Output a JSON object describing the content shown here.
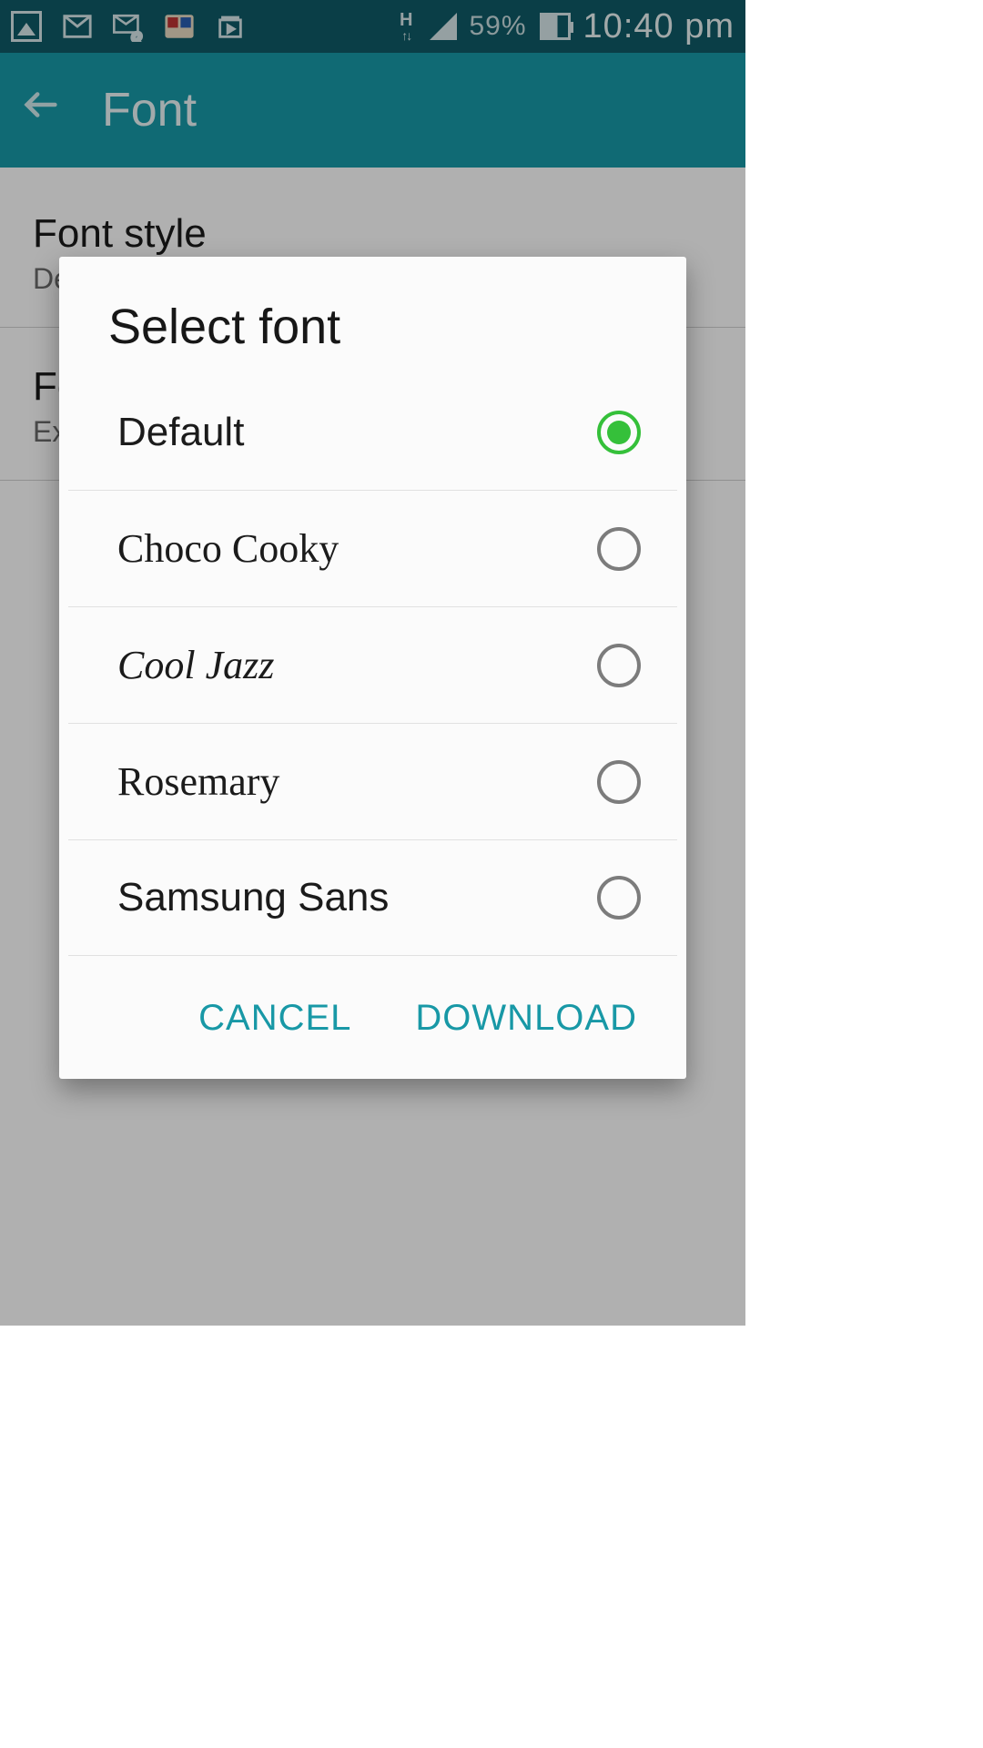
{
  "status_bar": {
    "network_indicator": "H",
    "battery_percent": "59%",
    "clock": "10:40 pm"
  },
  "app_bar": {
    "title": "Font"
  },
  "settings": {
    "font_style": {
      "title": "Font style",
      "value": "Default"
    },
    "font_size": {
      "title": "Font size",
      "value": "Extra large"
    }
  },
  "dialog": {
    "title": "Select font",
    "options": [
      {
        "label": "Default",
        "selected": true
      },
      {
        "label": "Choco Cooky",
        "selected": false
      },
      {
        "label": "Cool Jazz",
        "selected": false
      },
      {
        "label": "Rosemary",
        "selected": false
      },
      {
        "label": "Samsung Sans",
        "selected": false
      }
    ],
    "cancel_label": "CANCEL",
    "download_label": "DOWNLOAD"
  }
}
